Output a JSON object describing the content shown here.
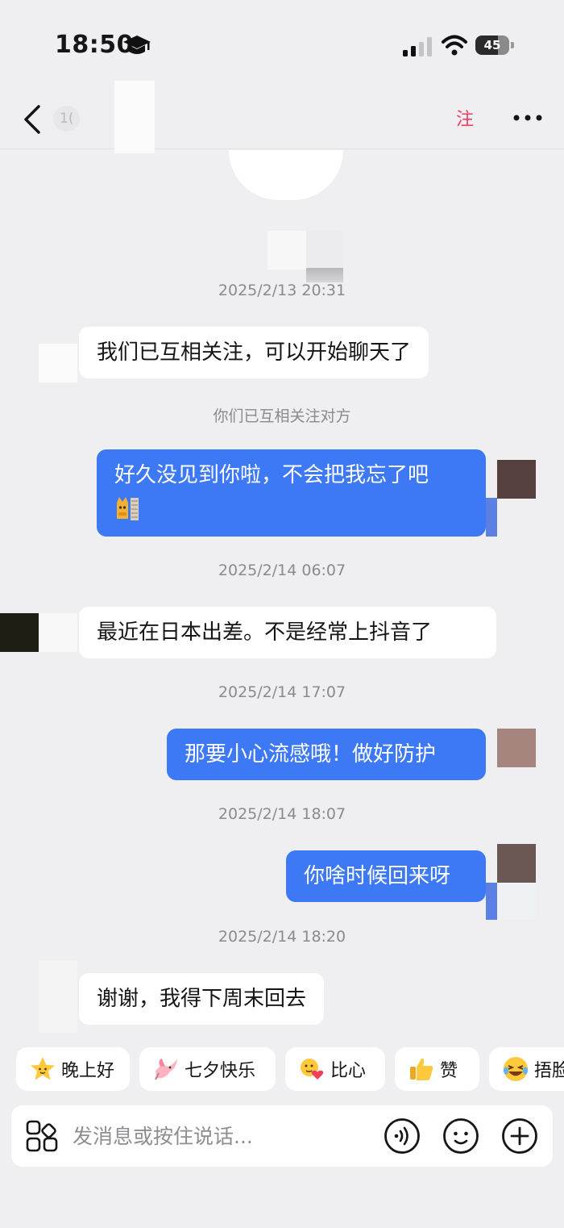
{
  "status_bar": {
    "time": "18:50",
    "battery": "45"
  },
  "header": {
    "id_fragment": "1(",
    "follow_label": "注"
  },
  "messages": [
    {
      "kind": "timestamp",
      "text": "2025/2/13 20:31"
    },
    {
      "kind": "incoming",
      "text": "我们已互相关注，可以开始聊天了"
    },
    {
      "kind": "system",
      "text": "你们已互相关注对方"
    },
    {
      "kind": "outgoing",
      "line1": "好久没见到你啦，不会把我忘了吧",
      "sticker": "cat-sticker-icon"
    },
    {
      "kind": "timestamp",
      "text": "2025/2/14 06:07"
    },
    {
      "kind": "incoming",
      "text": "最近在日本出差。不是经常上抖音了"
    },
    {
      "kind": "timestamp",
      "text": "2025/2/14 17:07"
    },
    {
      "kind": "outgoing",
      "text": "那要小心流感哦！做好防护"
    },
    {
      "kind": "timestamp",
      "text": "2025/2/14 18:07"
    },
    {
      "kind": "outgoing",
      "text": "你啥时候回来呀"
    },
    {
      "kind": "timestamp",
      "text": "2025/2/14 18:20"
    },
    {
      "kind": "incoming",
      "text": "谢谢，我得下周末回去"
    }
  ],
  "quick_replies": [
    {
      "icon": "star-emoji-icon",
      "label": "晚上好"
    },
    {
      "icon": "magpie-emoji-icon",
      "label": "七夕快乐"
    },
    {
      "icon": "heart-hands-emoji-icon",
      "label": "比心"
    },
    {
      "icon": "thumbs-up-emoji-icon",
      "label": "赞"
    },
    {
      "icon": "laughing-emoji-icon",
      "label": "捂脸"
    }
  ],
  "composer": {
    "placeholder": "发消息或按住说话..."
  },
  "colors": {
    "outgoing_bubble": "#3d78f5",
    "incoming_bubble": "#ffffff",
    "background": "#efeff1",
    "follow_accent": "#f03a5f"
  }
}
